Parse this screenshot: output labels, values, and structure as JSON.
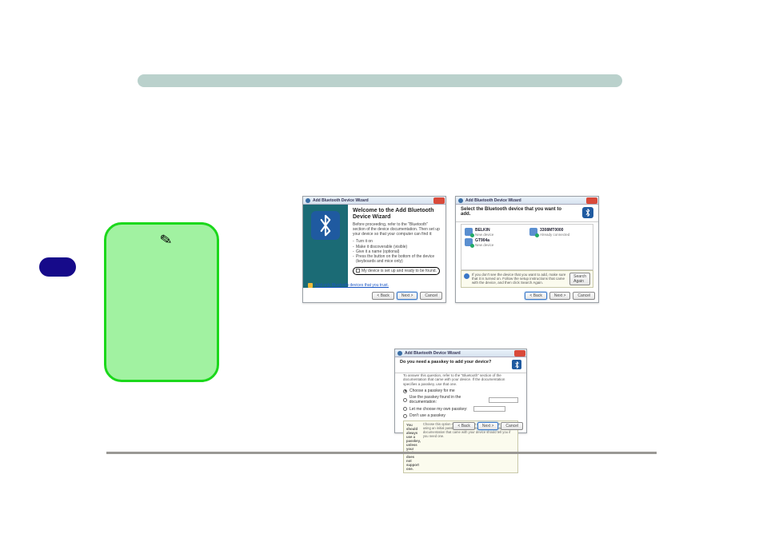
{
  "dialog1": {
    "title": "Add Bluetooth Device Wizard",
    "heading": "Welcome to the Add Bluetooth Device Wizard",
    "intro": "Before proceeding, refer to the \"Bluetooth\" section of the device documentation. Then set up your device so that your computer can find it:",
    "bullets": [
      "Turn it on",
      "Make it discoverable (visible)",
      "Give it a name (optional)",
      "Press the button on the bottom of the device (keyboards and mice only)"
    ],
    "checkbox_label": "My device is set up and ready to be found.",
    "link": "Add only Bluetooth devices that you trust.",
    "buttons": {
      "back": "< Back",
      "next": "Next >",
      "cancel": "Cancel"
    }
  },
  "dialog2": {
    "title": "Add Bluetooth Device Wizard",
    "heading": "Select the Bluetooth device that you want to add.",
    "devices": [
      {
        "name": "BELKIN",
        "sub": "New device"
      },
      {
        "name": "3308MT0000",
        "sub": "Already connected"
      },
      {
        "name": "GT904a",
        "sub": "New device"
      }
    ],
    "info": "If you don't see the device that you want to add, make sure that it is turned on. Follow the setup instructions that came with the device, and then click Search Again.",
    "search_again": "Search Again",
    "buttons": {
      "back": "< Back",
      "next": "Next >",
      "cancel": "Cancel"
    }
  },
  "dialog3": {
    "title": "Add Bluetooth Device Wizard",
    "heading": "Do you need a passkey to add your device?",
    "lead": "To answer this question, refer to the \"Bluetooth\" section of the documentation that came with your device. If the documentation specifies a passkey, use that one.",
    "options": {
      "o1": "Choose a passkey for me",
      "o2": "Use the passkey found in the documentation:",
      "o3": "Let me choose my own passkey:",
      "o4": "Don't use a passkey"
    },
    "note_left": "You should always use a passkey, unless your device does not support one.",
    "note_right": "Choose this option if your Bluetooth device does not support using an initial passkey. We recommend using a passkey. The documentation that came with your device should tell you if you need one.",
    "buttons": {
      "back": "< Back",
      "next": "Next >",
      "cancel": "Cancel"
    }
  },
  "icons": {
    "bluetooth": "฿"
  }
}
